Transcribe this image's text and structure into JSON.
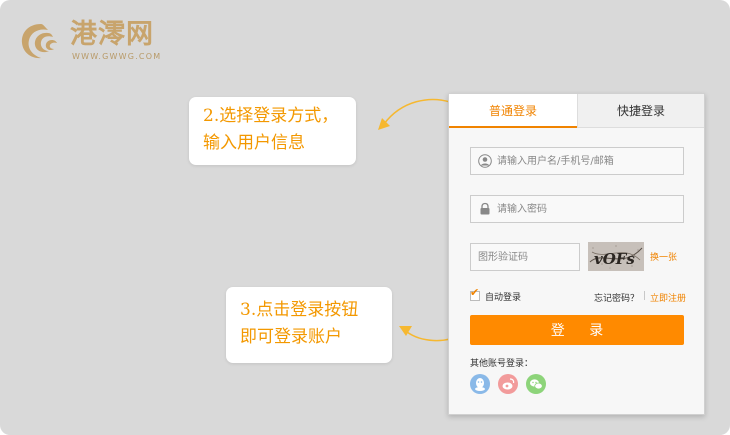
{
  "brand": {
    "name": "港澪网",
    "url": "WWW.GWWG.COM",
    "gold": "#c8a46c"
  },
  "callouts": {
    "step2": [
      "2.选择登录方式，",
      "输入用户信息"
    ],
    "step3": [
      "3.点击登录按钮",
      "即可登录账户"
    ],
    "color": "#f39800"
  },
  "login": {
    "tabs": [
      {
        "label": "普通登录",
        "active": true
      },
      {
        "label": "快捷登录",
        "active": false
      }
    ],
    "username_placeholder": "请输入用户名/手机号/邮箱",
    "password_placeholder": "请输入密码",
    "captcha_placeholder": "图形验证码",
    "captcha_text": "vOFs",
    "refresh_label": "换一张",
    "auto_login_label": "自动登录",
    "auto_login_checked": true,
    "forgot_label": "忘记密码？",
    "separator": "|",
    "register_label": "立即注册",
    "submit_label": "登 录",
    "other_accounts_label": "其他账号登录：",
    "social_icons": [
      "qq-icon",
      "weibo-icon",
      "wechat-icon"
    ],
    "accent": "#f08300"
  }
}
